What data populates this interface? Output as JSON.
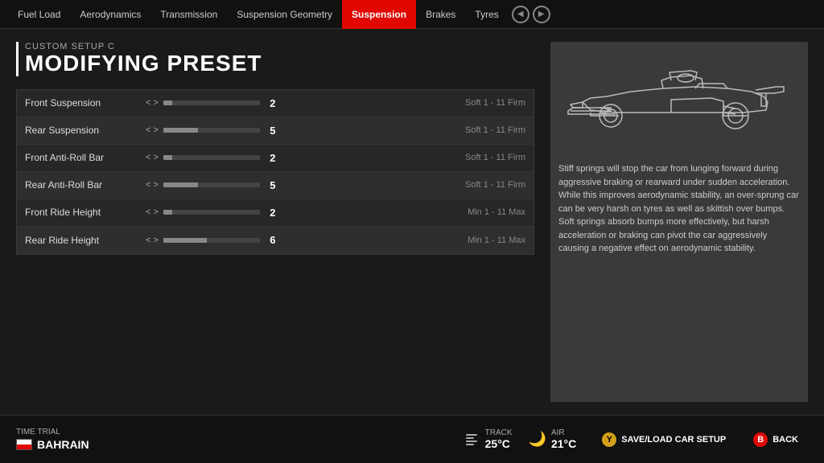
{
  "nav": {
    "items": [
      {
        "label": "Fuel Load",
        "active": false
      },
      {
        "label": "Aerodynamics",
        "active": false
      },
      {
        "label": "Transmission",
        "active": false
      },
      {
        "label": "Suspension Geometry",
        "active": false
      },
      {
        "label": "Suspension",
        "active": true
      },
      {
        "label": "Brakes",
        "active": false
      },
      {
        "label": "Tyres",
        "active": false
      }
    ]
  },
  "title_section": {
    "subtitle": "Custom Setup  C",
    "title": "MODIFYING PRESET"
  },
  "settings": [
    {
      "name": "Front Suspension",
      "value": 2,
      "max": 11,
      "range": "Soft 1 - 11 Firm",
      "fill_pct": 9
    },
    {
      "name": "Rear Suspension",
      "value": 5,
      "max": 11,
      "range": "Soft 1 - 11 Firm",
      "fill_pct": 36
    },
    {
      "name": "Front Anti-Roll Bar",
      "value": 2,
      "max": 11,
      "range": "Soft 1 - 11 Firm",
      "fill_pct": 9
    },
    {
      "name": "Rear Anti-Roll Bar",
      "value": 5,
      "max": 11,
      "range": "Soft 1 - 11 Firm",
      "fill_pct": 36
    },
    {
      "name": "Front Ride Height",
      "value": 2,
      "max": 11,
      "range": "Min 1 - 11 Max",
      "fill_pct": 9
    },
    {
      "name": "Rear Ride Height",
      "value": 6,
      "max": 11,
      "range": "Min 1 - 11 Max",
      "fill_pct": 45
    }
  ],
  "info_text": "Stiff springs will stop the car from lunging forward during aggressive braking or rearward under sudden acceleration. While this improves aerodynamic stability, an over-sprung car can be very harsh on tyres as well as skittish over bumps.\nSoft springs absorb bumps more effectively, but harsh acceleration or braking can pivot the car aggressively causing a negative effect on aerodynamic stability.",
  "bottom": {
    "race_type": "Time Trial",
    "location": "BAHRAIN",
    "track_label": "Track",
    "track_temp": "25°C",
    "air_label": "Air",
    "air_temp": "21°C",
    "save_button": "SAVE/LOAD CAR SETUP",
    "back_button": "BACK",
    "save_key": "Y",
    "back_key": "B"
  }
}
